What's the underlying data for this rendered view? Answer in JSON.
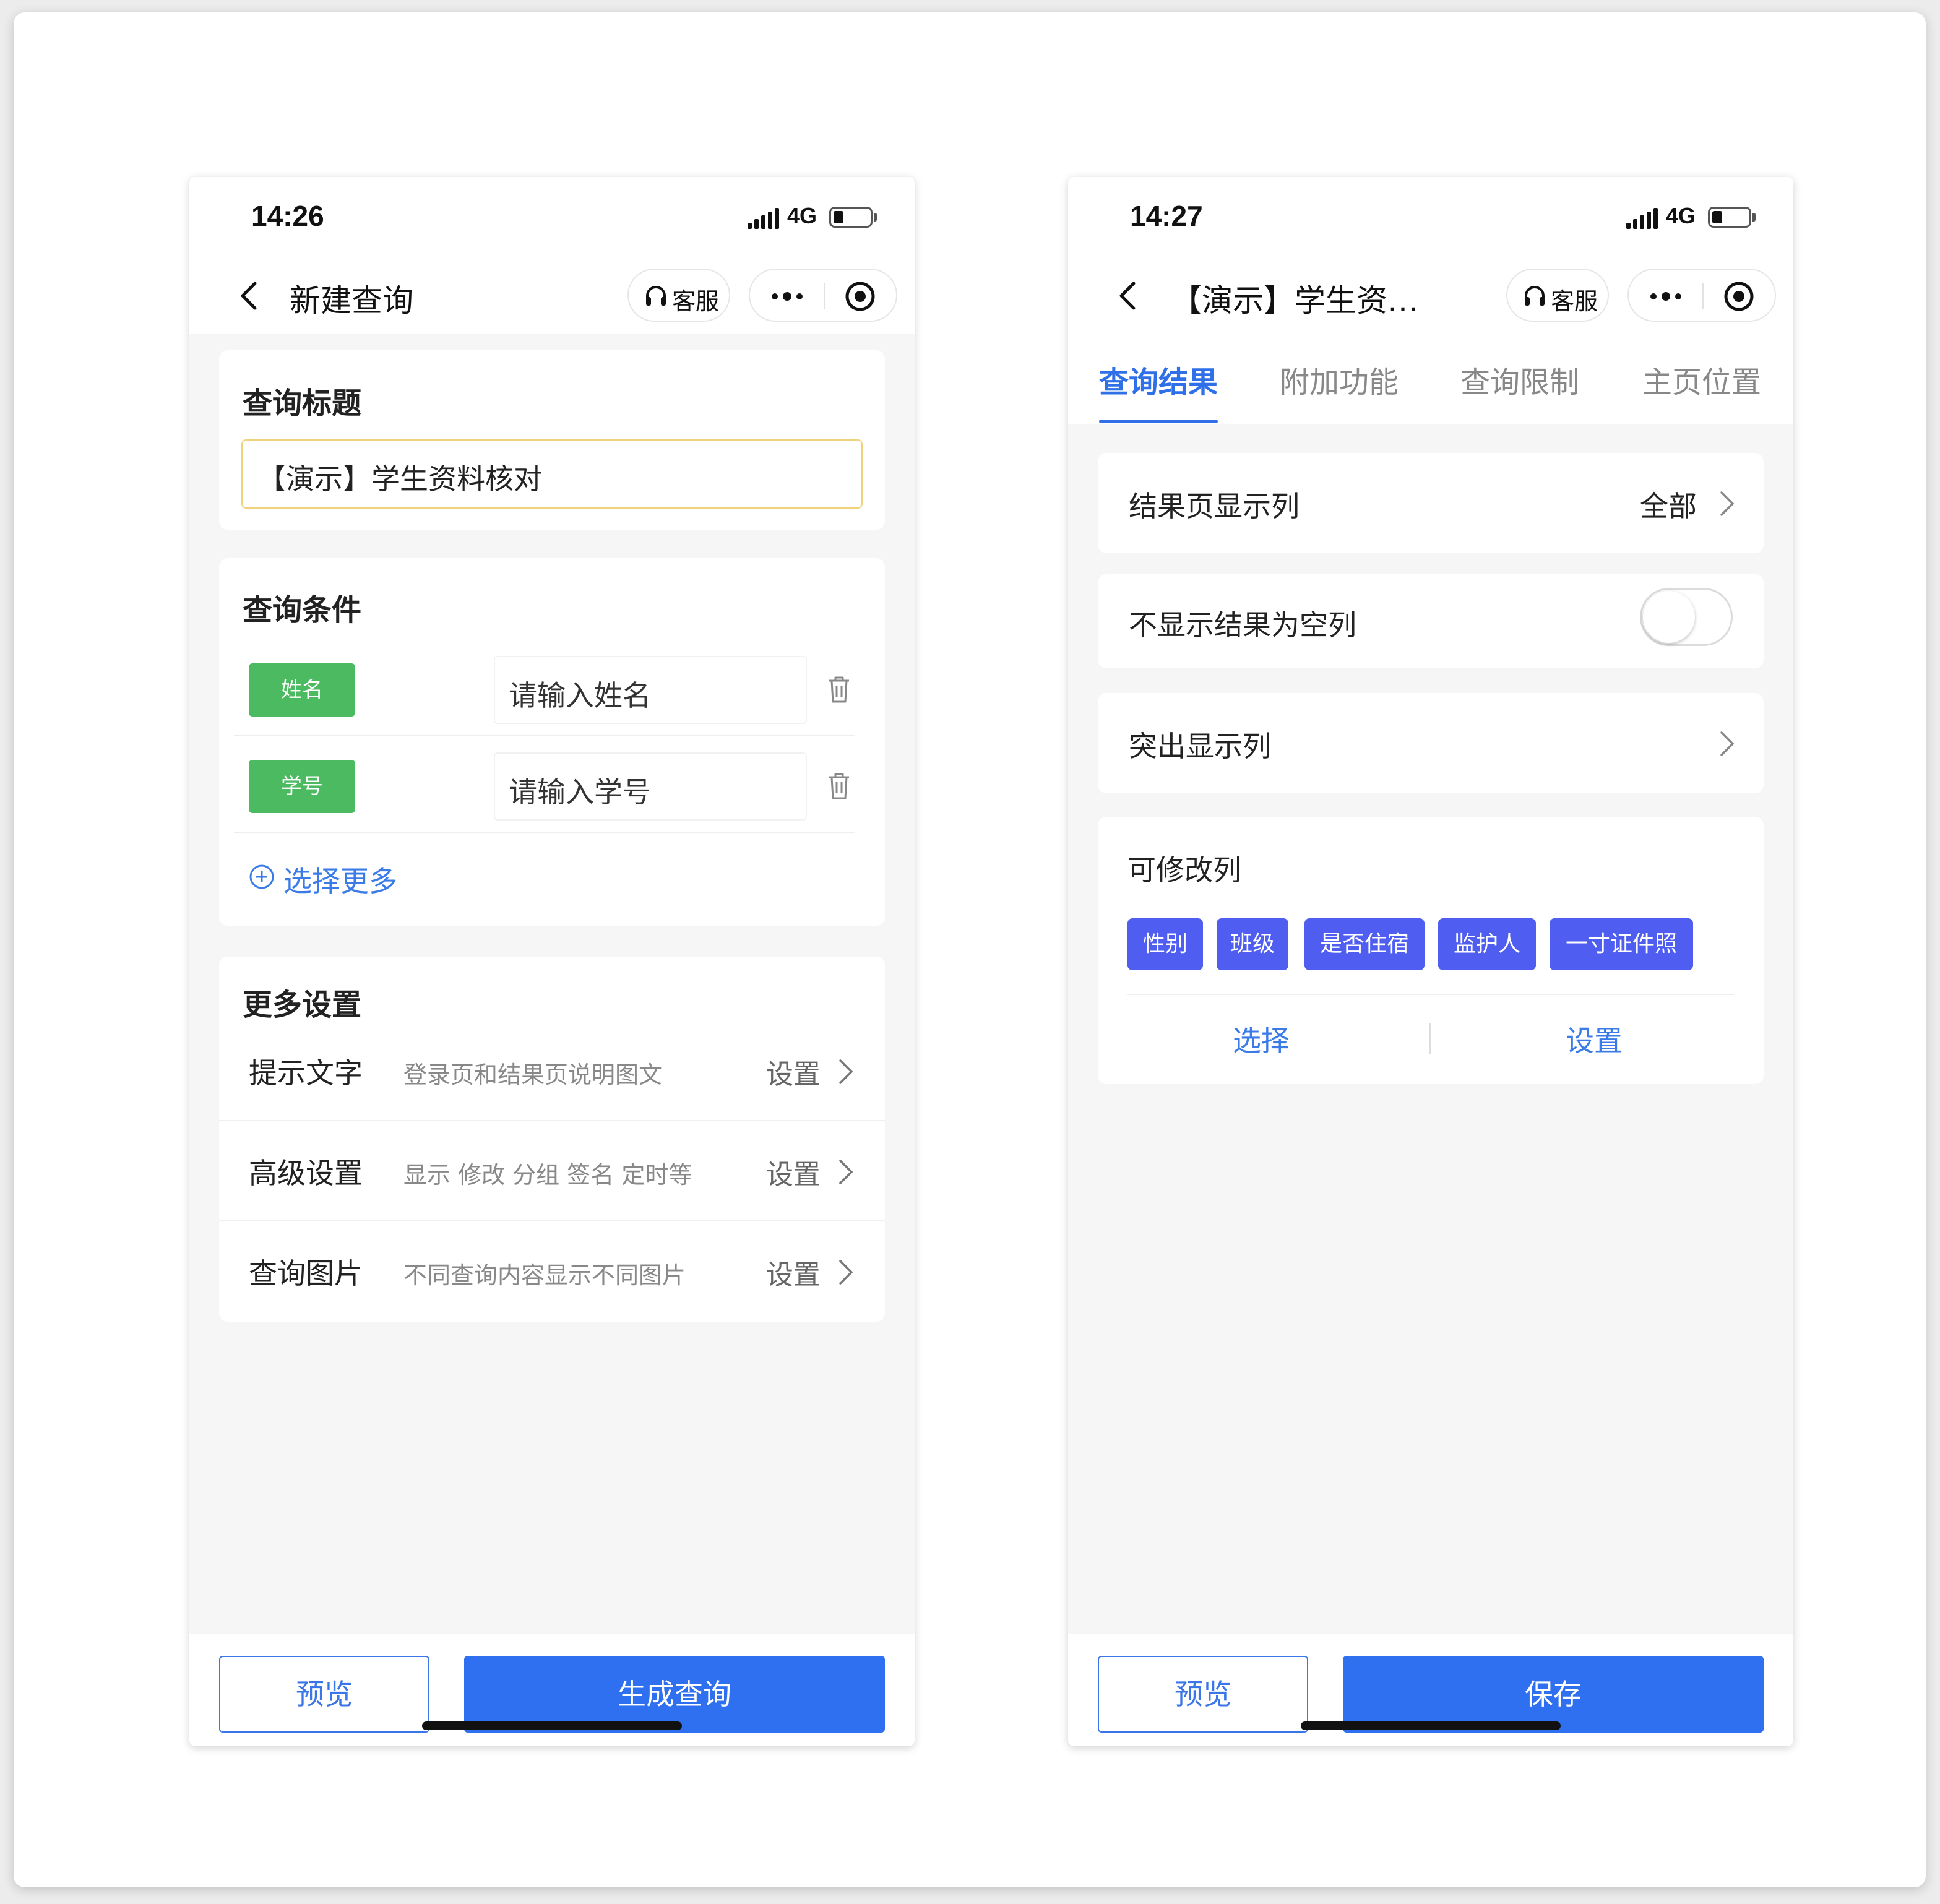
{
  "left_phone": {
    "status": {
      "time": "14:26",
      "network": "4G",
      "battery_level": 0.25
    },
    "nav": {
      "title": "新建查询",
      "service_label": "客服"
    },
    "title_card": {
      "heading": "查询标题",
      "value": "【演示】学生资料核对"
    },
    "conditions_card": {
      "heading": "查询条件",
      "rows": [
        {
          "tag": "姓名",
          "placeholder": "请输入姓名"
        },
        {
          "tag": "学号",
          "placeholder": "请输入学号"
        }
      ],
      "select_more": "选择更多"
    },
    "more_settings_card": {
      "heading": "更多设置",
      "rows": [
        {
          "name": "提示文字",
          "desc": "登录页和结果页说明图文",
          "action": "设置"
        },
        {
          "name": "高级设置",
          "desc": "显示 修改 分组 签名 定时等",
          "action": "设置"
        },
        {
          "name": "查询图片",
          "desc": "不同查询内容显示不同图片",
          "action": "设置"
        }
      ]
    },
    "bottom": {
      "preview": "预览",
      "primary": "生成查询"
    }
  },
  "right_phone": {
    "status": {
      "time": "14:27",
      "network": "4G",
      "battery_level": 0.25
    },
    "nav": {
      "title": "【演示】学生资…",
      "service_label": "客服"
    },
    "tabs": [
      "查询结果",
      "附加功能",
      "查询限制",
      "主页位置"
    ],
    "active_tab": 0,
    "result_columns": {
      "label": "结果页显示列",
      "value": "全部"
    },
    "hide_empty": {
      "label": "不显示结果为空列",
      "enabled": false
    },
    "highlight": {
      "label": "突出显示列"
    },
    "editable": {
      "heading": "可修改列",
      "chips": [
        "性别",
        "班级",
        "是否住宿",
        "监护人",
        "一寸证件照"
      ],
      "select": "选择",
      "settings": "设置"
    },
    "bottom": {
      "preview": "预览",
      "primary": "保存"
    }
  },
  "colors": {
    "primary_blue": "#2f70f0",
    "link_blue": "#3a7be8",
    "tag_green": "#4cba61",
    "chip_indigo": "#4f5ef0",
    "input_highlight": "#f0d27a"
  }
}
